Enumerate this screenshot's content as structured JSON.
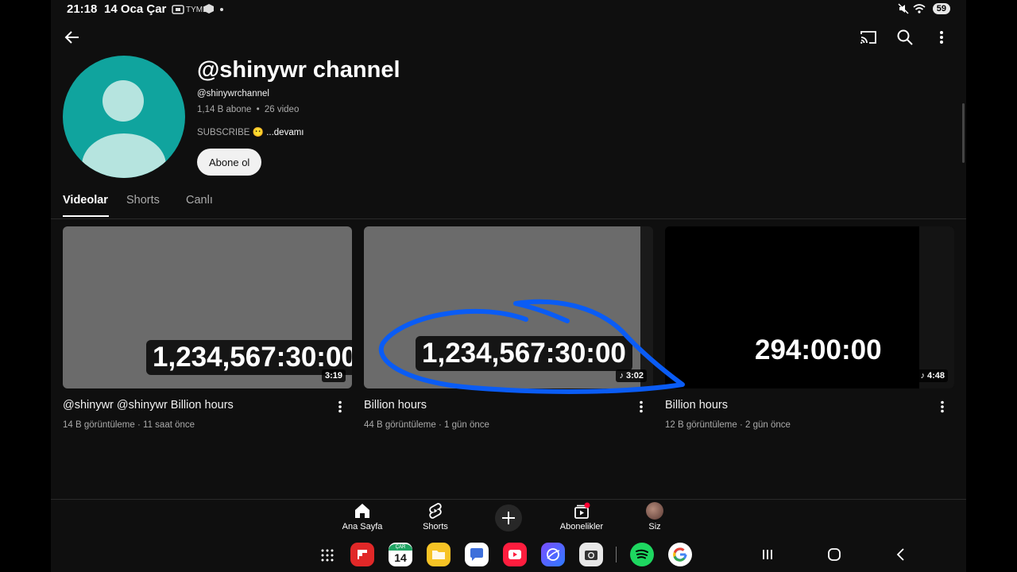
{
  "status_bar": {
    "time": "21:18",
    "date": "14 Oca Çar",
    "carrier_tag": "TYML",
    "battery": "59"
  },
  "header_icons": {
    "back": "back-arrow-icon",
    "cast": "cast-icon",
    "search": "search-icon",
    "more": "more-vert-icon"
  },
  "channel": {
    "title": "@shinywr channel",
    "handle": "@shinywrchannel",
    "subscribers": "1,14 B abone",
    "separator": "•",
    "video_count": "26 video",
    "description": "SUBSCRIBE 😶",
    "more_label": "...devamı",
    "subscribe_label": "Abone ol"
  },
  "tabs": [
    {
      "label": "Videolar",
      "active": true
    },
    {
      "label": "Shorts",
      "active": false
    },
    {
      "label": "Canlı",
      "active": false
    }
  ],
  "videos": [
    {
      "title": "@shinywr @shinywr  Billion hours",
      "views": "14 B görüntüleme",
      "age": "11 saat önce",
      "duration": "3:19",
      "thumb_text": "1,234,567:30:00",
      "music": false
    },
    {
      "title": "Billion hours",
      "views": "44 B görüntüleme",
      "age": "1 gün önce",
      "duration": "3:02",
      "thumb_text": "1,234,567:30:00",
      "music": true
    },
    {
      "title": "Billion hours",
      "views": "12 B görüntüleme",
      "age": "2 gün önce",
      "duration": "4:48",
      "thumb_text": "294:00:00",
      "music": true
    }
  ],
  "meta_sep": "·",
  "bottom_nav": [
    {
      "label": "Ana Sayfa",
      "icon": "home-icon"
    },
    {
      "label": "Shorts",
      "icon": "shorts-icon"
    },
    {
      "label": "",
      "icon": "create-plus-icon"
    },
    {
      "label": "Abonelikler",
      "icon": "subscriptions-icon"
    },
    {
      "label": "Siz",
      "icon": "profile-avatar-icon"
    }
  ],
  "dock": {
    "calendar_day": "14",
    "calendar_month": "ÇAR",
    "apps": [
      "app-drawer-icon",
      "flipboard-icon",
      "calendar-icon",
      "my-files-icon",
      "messages-icon",
      "youtube-icon",
      "internet-icon",
      "camera-icon",
      "spotify-icon",
      "google-icon"
    ]
  },
  "colors": {
    "background": "#0f0f0f",
    "avatar": "#10a49e",
    "annotation": "#0a5cf5"
  }
}
